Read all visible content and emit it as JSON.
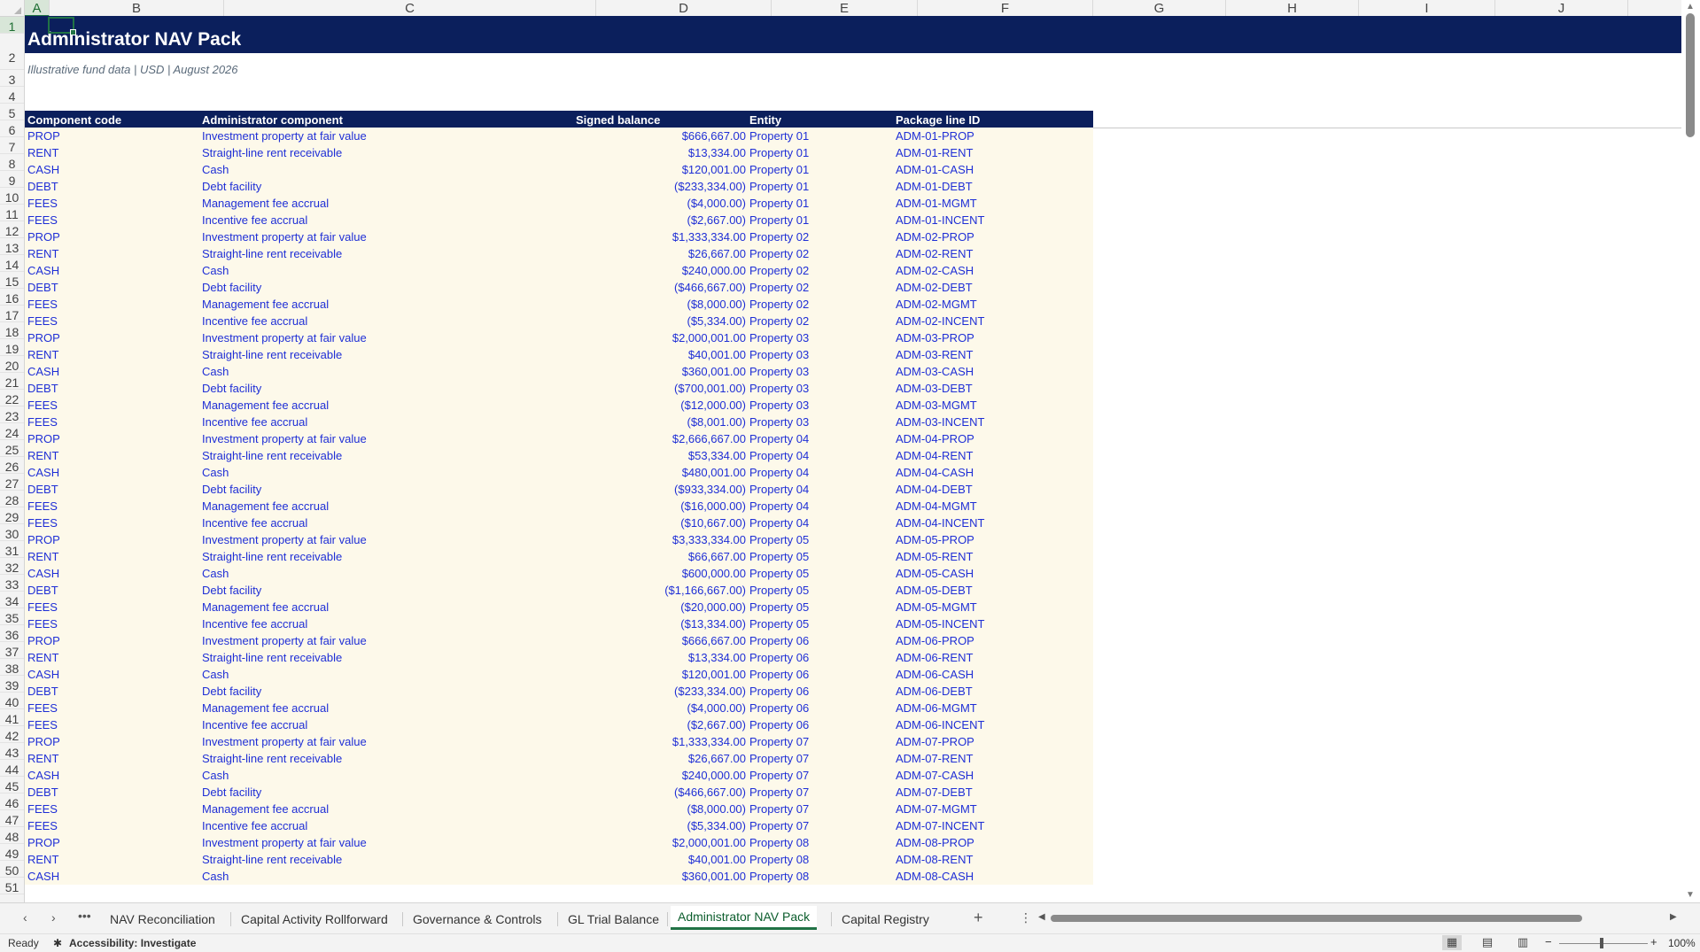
{
  "columns": [
    "A",
    "B",
    "C",
    "D",
    "E",
    "F",
    "G",
    "H",
    "I",
    "J"
  ],
  "selected_column": "A",
  "row_numbers": [
    1,
    2,
    3,
    4,
    5,
    6,
    7,
    8,
    9,
    10,
    11,
    12,
    13,
    14,
    15,
    16,
    17,
    18,
    19,
    20,
    21,
    22,
    23,
    24,
    25,
    26,
    27,
    28,
    29,
    30,
    31,
    32,
    33,
    34,
    35,
    36,
    37,
    38,
    39,
    40,
    41,
    42,
    43,
    44,
    45,
    46,
    47,
    48,
    49,
    50,
    51
  ],
  "selected_row": 1,
  "sheet": {
    "title": "Administrator NAV Pack",
    "subtitle": "Illustrative fund data | USD | August 2026"
  },
  "table": {
    "headers": [
      "Component code",
      "Administrator component",
      "Signed balance",
      "Entity",
      "Package line ID"
    ],
    "rows": [
      [
        "PROP",
        "Investment property at fair value",
        "$666,667.00",
        "Property 01",
        "ADM-01-PROP"
      ],
      [
        "RENT",
        "Straight-line rent receivable",
        "$13,334.00",
        "Property 01",
        "ADM-01-RENT"
      ],
      [
        "CASH",
        "Cash",
        "$120,001.00",
        "Property 01",
        "ADM-01-CASH"
      ],
      [
        "DEBT",
        "Debt facility",
        "($233,334.00)",
        "Property 01",
        "ADM-01-DEBT"
      ],
      [
        "FEES",
        "Management fee accrual",
        "($4,000.00)",
        "Property 01",
        "ADM-01-MGMT"
      ],
      [
        "FEES",
        "Incentive fee accrual",
        "($2,667.00)",
        "Property 01",
        "ADM-01-INCENT"
      ],
      [
        "PROP",
        "Investment property at fair value",
        "$1,333,334.00",
        "Property 02",
        "ADM-02-PROP"
      ],
      [
        "RENT",
        "Straight-line rent receivable",
        "$26,667.00",
        "Property 02",
        "ADM-02-RENT"
      ],
      [
        "CASH",
        "Cash",
        "$240,000.00",
        "Property 02",
        "ADM-02-CASH"
      ],
      [
        "DEBT",
        "Debt facility",
        "($466,667.00)",
        "Property 02",
        "ADM-02-DEBT"
      ],
      [
        "FEES",
        "Management fee accrual",
        "($8,000.00)",
        "Property 02",
        "ADM-02-MGMT"
      ],
      [
        "FEES",
        "Incentive fee accrual",
        "($5,334.00)",
        "Property 02",
        "ADM-02-INCENT"
      ],
      [
        "PROP",
        "Investment property at fair value",
        "$2,000,001.00",
        "Property 03",
        "ADM-03-PROP"
      ],
      [
        "RENT",
        "Straight-line rent receivable",
        "$40,001.00",
        "Property 03",
        "ADM-03-RENT"
      ],
      [
        "CASH",
        "Cash",
        "$360,001.00",
        "Property 03",
        "ADM-03-CASH"
      ],
      [
        "DEBT",
        "Debt facility",
        "($700,001.00)",
        "Property 03",
        "ADM-03-DEBT"
      ],
      [
        "FEES",
        "Management fee accrual",
        "($12,000.00)",
        "Property 03",
        "ADM-03-MGMT"
      ],
      [
        "FEES",
        "Incentive fee accrual",
        "($8,001.00)",
        "Property 03",
        "ADM-03-INCENT"
      ],
      [
        "PROP",
        "Investment property at fair value",
        "$2,666,667.00",
        "Property 04",
        "ADM-04-PROP"
      ],
      [
        "RENT",
        "Straight-line rent receivable",
        "$53,334.00",
        "Property 04",
        "ADM-04-RENT"
      ],
      [
        "CASH",
        "Cash",
        "$480,001.00",
        "Property 04",
        "ADM-04-CASH"
      ],
      [
        "DEBT",
        "Debt facility",
        "($933,334.00)",
        "Property 04",
        "ADM-04-DEBT"
      ],
      [
        "FEES",
        "Management fee accrual",
        "($16,000.00)",
        "Property 04",
        "ADM-04-MGMT"
      ],
      [
        "FEES",
        "Incentive fee accrual",
        "($10,667.00)",
        "Property 04",
        "ADM-04-INCENT"
      ],
      [
        "PROP",
        "Investment property at fair value",
        "$3,333,334.00",
        "Property 05",
        "ADM-05-PROP"
      ],
      [
        "RENT",
        "Straight-line rent receivable",
        "$66,667.00",
        "Property 05",
        "ADM-05-RENT"
      ],
      [
        "CASH",
        "Cash",
        "$600,000.00",
        "Property 05",
        "ADM-05-CASH"
      ],
      [
        "DEBT",
        "Debt facility",
        "($1,166,667.00)",
        "Property 05",
        "ADM-05-DEBT"
      ],
      [
        "FEES",
        "Management fee accrual",
        "($20,000.00)",
        "Property 05",
        "ADM-05-MGMT"
      ],
      [
        "FEES",
        "Incentive fee accrual",
        "($13,334.00)",
        "Property 05",
        "ADM-05-INCENT"
      ],
      [
        "PROP",
        "Investment property at fair value",
        "$666,667.00",
        "Property 06",
        "ADM-06-PROP"
      ],
      [
        "RENT",
        "Straight-line rent receivable",
        "$13,334.00",
        "Property 06",
        "ADM-06-RENT"
      ],
      [
        "CASH",
        "Cash",
        "$120,001.00",
        "Property 06",
        "ADM-06-CASH"
      ],
      [
        "DEBT",
        "Debt facility",
        "($233,334.00)",
        "Property 06",
        "ADM-06-DEBT"
      ],
      [
        "FEES",
        "Management fee accrual",
        "($4,000.00)",
        "Property 06",
        "ADM-06-MGMT"
      ],
      [
        "FEES",
        "Incentive fee accrual",
        "($2,667.00)",
        "Property 06",
        "ADM-06-INCENT"
      ],
      [
        "PROP",
        "Investment property at fair value",
        "$1,333,334.00",
        "Property 07",
        "ADM-07-PROP"
      ],
      [
        "RENT",
        "Straight-line rent receivable",
        "$26,667.00",
        "Property 07",
        "ADM-07-RENT"
      ],
      [
        "CASH",
        "Cash",
        "$240,000.00",
        "Property 07",
        "ADM-07-CASH"
      ],
      [
        "DEBT",
        "Debt facility",
        "($466,667.00)",
        "Property 07",
        "ADM-07-DEBT"
      ],
      [
        "FEES",
        "Management fee accrual",
        "($8,000.00)",
        "Property 07",
        "ADM-07-MGMT"
      ],
      [
        "FEES",
        "Incentive fee accrual",
        "($5,334.00)",
        "Property 07",
        "ADM-07-INCENT"
      ],
      [
        "PROP",
        "Investment property at fair value",
        "$2,000,001.00",
        "Property 08",
        "ADM-08-PROP"
      ],
      [
        "RENT",
        "Straight-line rent receivable",
        "$40,001.00",
        "Property 08",
        "ADM-08-RENT"
      ],
      [
        "CASH",
        "Cash",
        "$360,001.00",
        "Property 08",
        "ADM-08-CASH"
      ]
    ]
  },
  "tabs": {
    "prev_icon": "chevron-left-icon",
    "next_icon": "chevron-right-icon",
    "more_label": "•••",
    "items": [
      "NAV Reconciliation",
      "Capital Activity Rollforward",
      "Governance & Controls",
      "GL Trial Balance",
      "Administrator NAV Pack",
      "Capital Registry"
    ],
    "active": "Administrator NAV Pack",
    "add_label": "+",
    "options_label": "⋮"
  },
  "status": {
    "ready": "Ready",
    "accessibility": "Accessibility: Investigate",
    "zoom": "100%",
    "zoom_minus": "−",
    "zoom_plus": "+"
  },
  "colors": {
    "title_band": "#0b1f5c",
    "table_fill": "#fdf9ea",
    "input_text": "#1f2fd6",
    "accent": "#217346"
  }
}
